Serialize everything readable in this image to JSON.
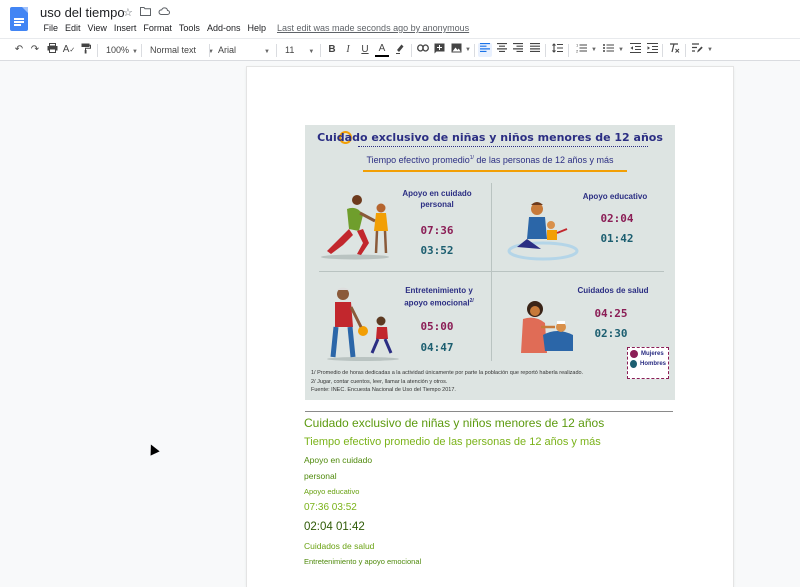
{
  "header": {
    "title": "uso del tiempo",
    "last_edit": "Last edit was made seconds ago by anonymous"
  },
  "menu": [
    "File",
    "Edit",
    "View",
    "Insert",
    "Format",
    "Tools",
    "Add-ons",
    "Help"
  ],
  "toolbar": {
    "zoom": "100%",
    "style": "Normal text",
    "font": "Arial",
    "font_size": "11"
  },
  "infographic": {
    "title": "Cuidado exclusivo de niñas y niños menores de 12 años",
    "subtitle": "Tiempo efectivo promedio",
    "subtitle_sup": "1/",
    "subtitle_rest": " de las personas de 12 años y más",
    "panels": [
      {
        "label_line1": "Apoyo en cuidado",
        "label_line2": "personal",
        "mujeres": "07:36",
        "hombres": "03:52"
      },
      {
        "label_line1": "Apoyo educativo",
        "label_line2": "",
        "mujeres": "02:04",
        "hombres": "01:42"
      },
      {
        "label_line1": "Entretenimiento y",
        "label_line2": "apoyo emocional",
        "label_sup": "2/",
        "mujeres": "05:00",
        "hombres": "04:47"
      },
      {
        "label_line1": "Cuidados de salud",
        "label_line2": "",
        "mujeres": "04:25",
        "hombres": "02:30"
      }
    ],
    "legend": {
      "mujeres": "Mujeres",
      "hombres": "Hombres"
    },
    "notes": [
      "1/ Promedio de horas dedicadas a la actividad únicamente por parte la población que reportó haberla realizado.",
      "2/ Jugar, contar cuentos, leer, llamar la atención y otros.",
      "Fuente: INEC. Encuesta Nacional de Uso del Tiempo 2017."
    ],
    "colors": {
      "mujeres": "#8b1e56",
      "hombres": "#1c5e70",
      "accent": "#f29f05",
      "title": "#2b2e83"
    }
  },
  "ocr_text": [
    "Cuidado exclusivo de niñas y niños menores de 12 años",
    "Tiempo efectivo promedio de las personas de 12 años y más",
    "Apoyo en cuidado",
    "personal",
    "Apoyo educativo",
    "07:36 03:52",
    "02:04 01:42",
    "Cuidados de salud",
    "Entretenimiento y apoyo emocional"
  ]
}
